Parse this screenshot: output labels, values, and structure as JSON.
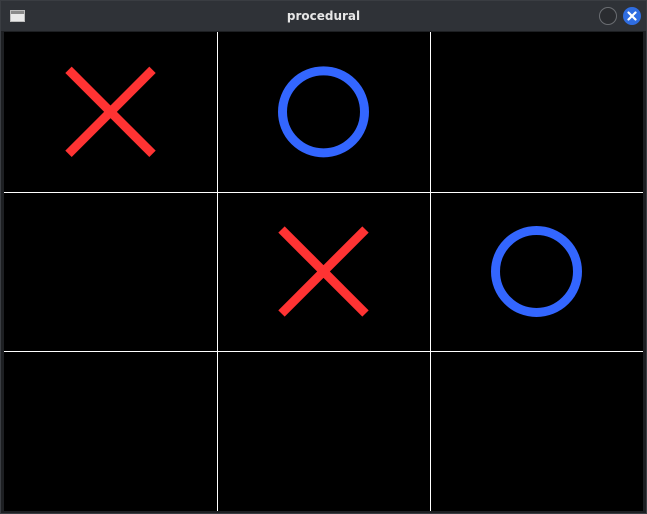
{
  "window": {
    "title": "procedural",
    "icons": {
      "app": "window-app-icon",
      "minimize": "minimize-icon",
      "close": "close-icon"
    },
    "colors": {
      "close_button": "#2f6de1"
    }
  },
  "game": {
    "rows": 3,
    "cols": 3,
    "board": [
      [
        "X",
        "O",
        ""
      ],
      [
        "",
        "X",
        "O"
      ],
      [
        "",
        "",
        ""
      ]
    ],
    "colors": {
      "background": "#000000",
      "grid": "#ffffff",
      "x_mark": "#ff3333",
      "o_mark": "#3366ff"
    }
  }
}
